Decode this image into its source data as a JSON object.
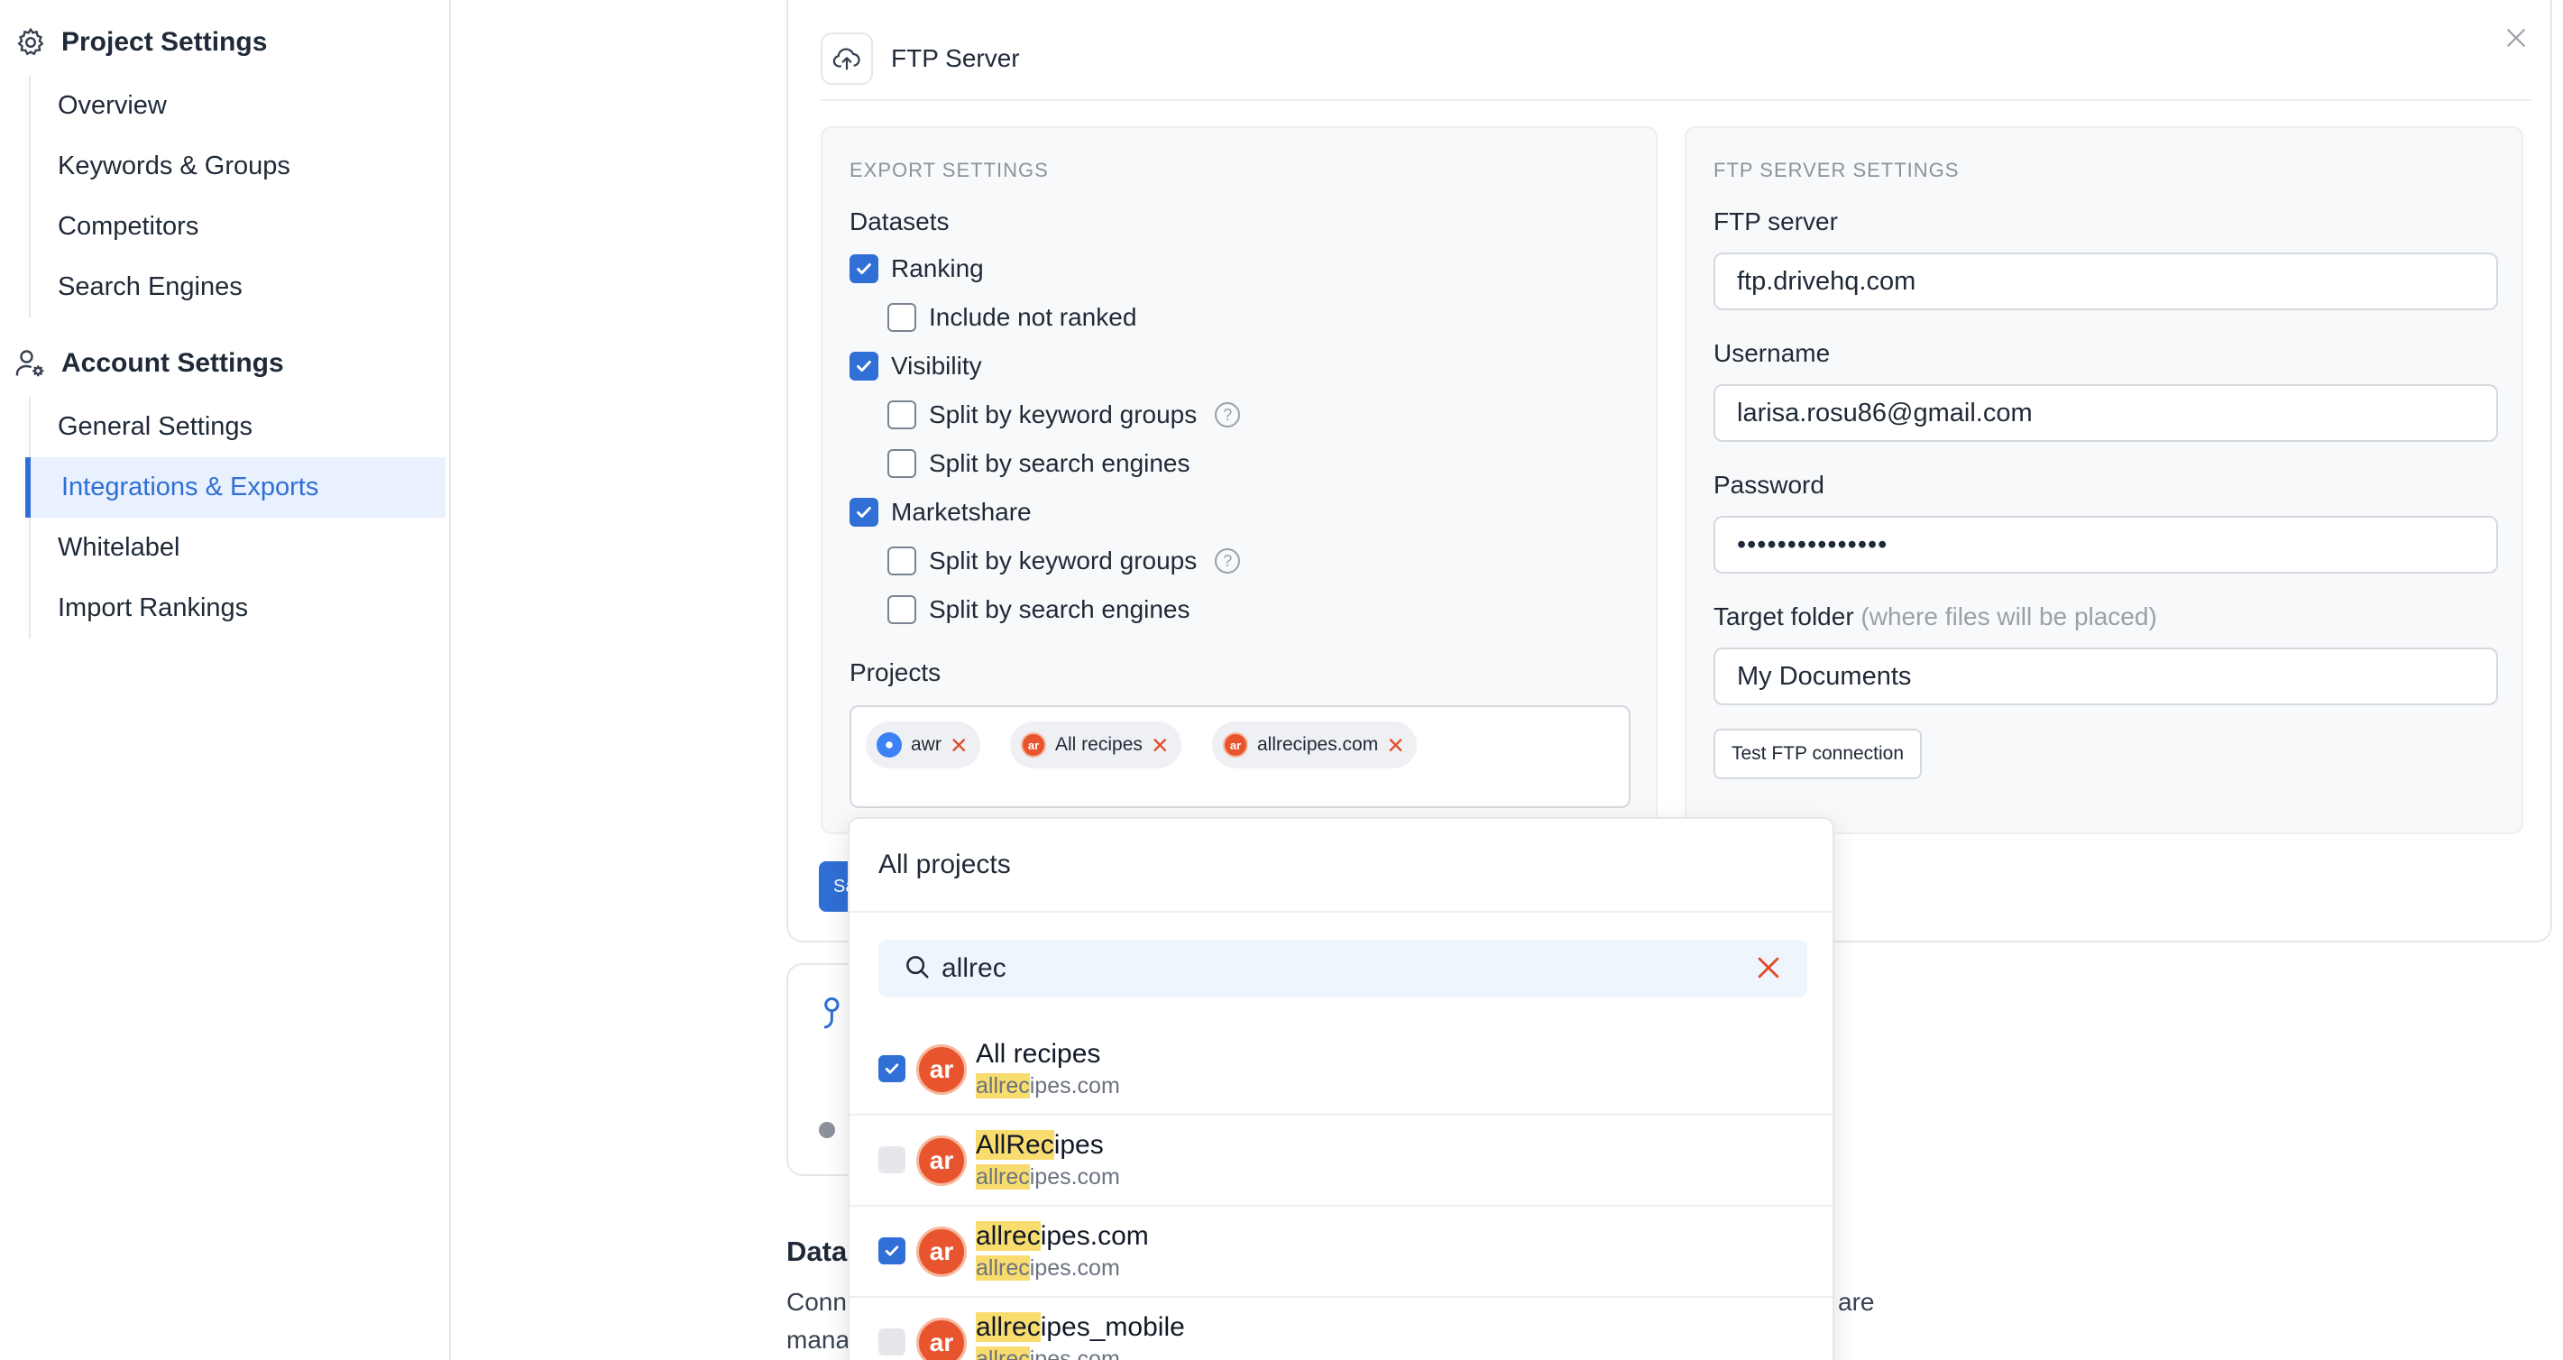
{
  "sidebar": {
    "project_settings": {
      "title": "Project Settings",
      "items": [
        "Overview",
        "Keywords & Groups",
        "Competitors",
        "Search Engines"
      ]
    },
    "account_settings": {
      "title": "Account Settings",
      "items": [
        "General Settings",
        "Integrations & Exports",
        "Whitelabel",
        "Import Rankings"
      ],
      "active": "Integrations & Exports"
    }
  },
  "card": {
    "title": "FTP Server",
    "save_label": "Sa"
  },
  "export": {
    "section_label": "EXPORT SETTINGS",
    "datasets_label": "Datasets",
    "ranking": {
      "label": "Ranking",
      "checked": true
    },
    "include_not_ranked": {
      "label": "Include not ranked",
      "checked": false
    },
    "visibility": {
      "label": "Visibility",
      "checked": true
    },
    "vis_split_groups": {
      "label": "Split by keyword groups",
      "checked": false
    },
    "vis_split_engines": {
      "label": "Split by search engines",
      "checked": false
    },
    "marketshare": {
      "label": "Marketshare",
      "checked": true
    },
    "ms_split_groups": {
      "label": "Split by keyword groups",
      "checked": false
    },
    "ms_split_engines": {
      "label": "Split by search engines",
      "checked": false
    },
    "projects_label": "Projects",
    "chips": [
      "awr",
      "All recipes",
      "allrecipes.com"
    ]
  },
  "ftp": {
    "section_label": "FTP SERVER SETTINGS",
    "server_label": "FTP server",
    "server_value": "ftp.drivehq.com",
    "username_label": "Username",
    "username_value": "larisa.rosu86@gmail.com",
    "password_label": "Password",
    "password_value": "•••••••••••••••",
    "folder_label": "Target folder",
    "folder_hint": "(where files will be placed)",
    "folder_value": "My Documents",
    "test_button": "Test FTP connection"
  },
  "dropdown": {
    "header": "All projects",
    "search_value": "allrec",
    "items": [
      {
        "name_pre": "",
        "name_hl": "",
        "name_post": "All recipes",
        "domain_hl": "allrec",
        "domain_post": "ipes.com",
        "checked": true
      },
      {
        "name_pre": "",
        "name_hl": "AllRec",
        "name_post": "ipes",
        "domain_hl": "allrec",
        "domain_post": "ipes.com",
        "checked": false
      },
      {
        "name_pre": "",
        "name_hl": "allrec",
        "name_post": "ipes.com",
        "domain_hl": "allrec",
        "domain_post": "ipes.com",
        "checked": true
      },
      {
        "name_pre": "",
        "name_hl": "allrec",
        "name_post": "ipes_mobile",
        "domain_hl": "allrec",
        "domain_post": "ipes.com",
        "checked": false
      }
    ]
  },
  "background": {
    "title_fragment": "Data",
    "line1_start": "Conn",
    "line1_end": "are",
    "line2_start": "mana"
  },
  "colors": {
    "accent": "#2f6fd6",
    "danger": "#e04b2a",
    "highlight": "#f8dd6e",
    "avatar": "#e8542e"
  },
  "icons": {
    "project_settings": "gear-icon",
    "account_settings": "user-gear-icon",
    "card_header": "cloud-upload-icon",
    "close": "close-icon",
    "search": "search-icon",
    "help": "help-circle-icon"
  }
}
